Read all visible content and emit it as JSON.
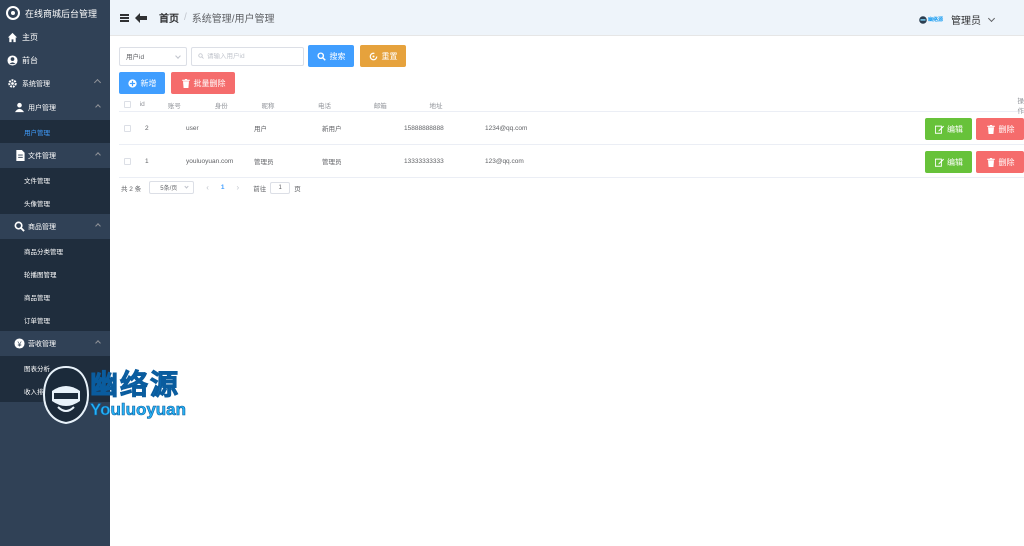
{
  "app": {
    "title": "在线商城后台管理"
  },
  "sidebar": {
    "home": "主页",
    "frontend": "前台",
    "system": {
      "label": "系统管理",
      "groups": [
        {
          "label": "用户管理",
          "items": [
            "用户管理"
          ]
        },
        {
          "label": "文件管理",
          "items": [
            "文件管理",
            "头像管理"
          ]
        },
        {
          "label": "商品管理",
          "items": [
            "商品分类管理",
            "轮播图管理",
            "商品管理",
            "订单管理"
          ]
        },
        {
          "label": "营收管理",
          "items": [
            "图表分析",
            "收入排行"
          ]
        }
      ]
    }
  },
  "header": {
    "breadcrumb_home": "首页",
    "breadcrumb_sep": "/",
    "breadcrumb_path": "系统管理/用户管理",
    "user_name": "管理员",
    "avatar_text": "幽络源"
  },
  "toolbar": {
    "select_value": "用户id",
    "search_placeholder": "请输入用户id",
    "search_label": "搜索",
    "reset_label": "重置",
    "add_label": "新增",
    "batch_delete_label": "批量删除"
  },
  "table": {
    "headers": [
      "id",
      "账号",
      "身份",
      "昵称",
      "电话",
      "邮箱",
      "地址",
      "操作"
    ],
    "rows": [
      {
        "id": "2",
        "account": "user",
        "role": "用户",
        "nickname": "新用户",
        "phone": "15888888888",
        "email": "1234@qq.com",
        "address": ""
      },
      {
        "id": "1",
        "account": "youluoyuan.com",
        "role": "管理员",
        "nickname": "管理员",
        "phone": "13333333333",
        "email": "123@qq.com",
        "address": ""
      }
    ],
    "edit_label": "编辑",
    "delete_label": "删除"
  },
  "pagination": {
    "total": "共 2 条",
    "page_size": "5条/页",
    "prev": "‹",
    "current_page": "1",
    "next": "›",
    "goto_prefix": "前往",
    "goto_value": "1",
    "goto_suffix": "页"
  },
  "watermark": {
    "cn": "幽络源",
    "en": "Youluoyuan"
  },
  "colors": {
    "sidebar": "#304156",
    "primary": "#409eff",
    "warning": "#e6a23c",
    "danger": "#f56c6c",
    "success": "#67c23a"
  }
}
